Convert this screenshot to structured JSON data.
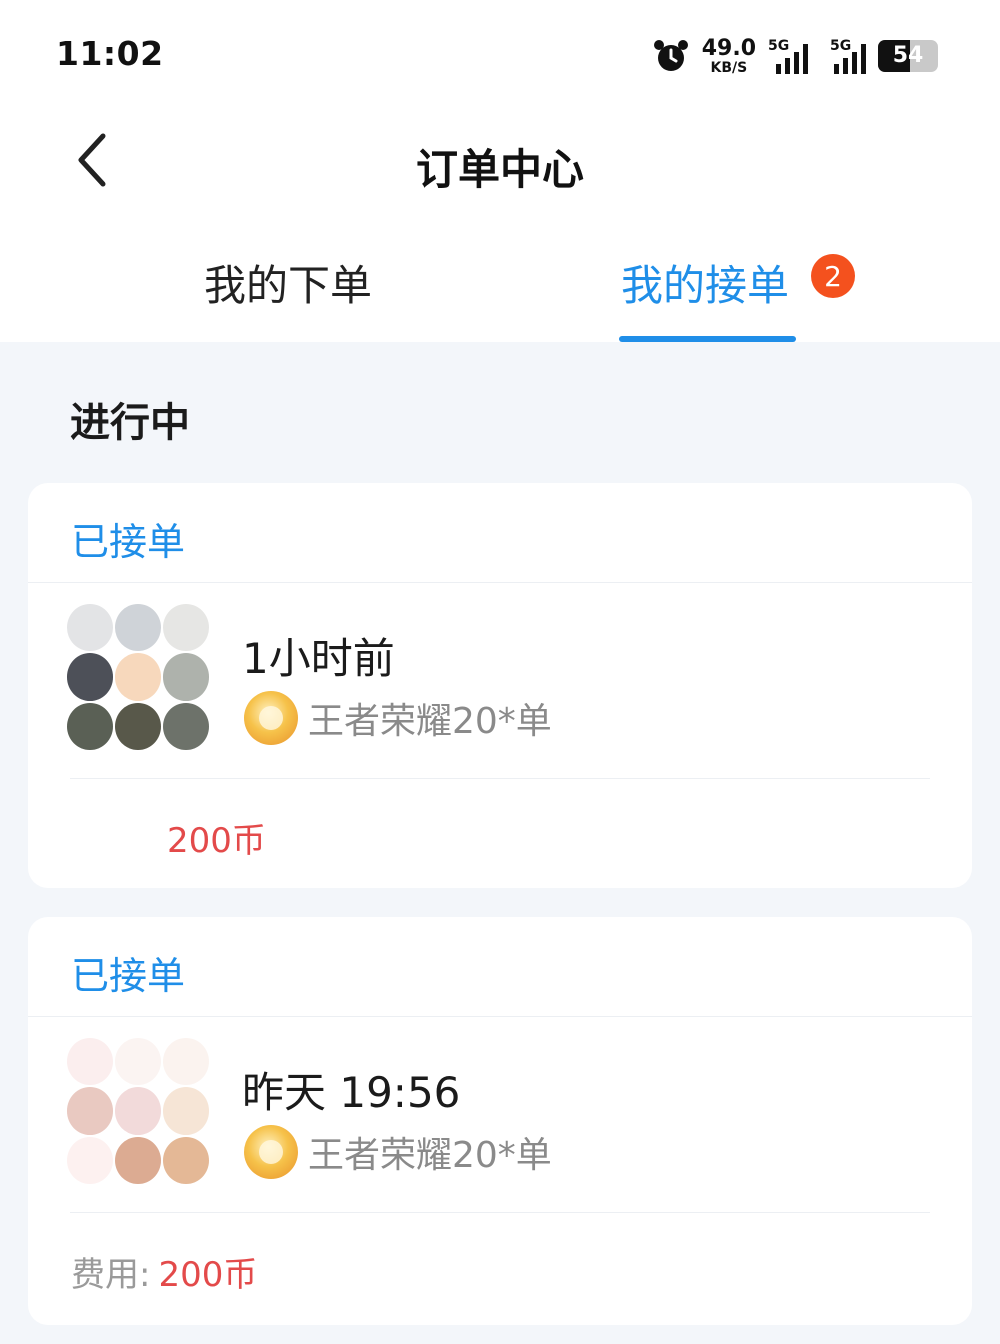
{
  "status_bar": {
    "time": "11:02",
    "net_speed_value": "49.0",
    "net_speed_unit": "KB/S",
    "signal_1_tag": "5G",
    "signal_2_tag": "5G",
    "battery_level": "54",
    "icons": [
      "alarm-icon",
      "signal-icon",
      "signal-icon",
      "battery-icon"
    ]
  },
  "header": {
    "title": "订单中心",
    "back_icon": "chevron-left-icon"
  },
  "tabs": [
    {
      "label": "我的下单",
      "active": false
    },
    {
      "label": "我的接单",
      "active": true,
      "badge": "2"
    }
  ],
  "colors": {
    "accent": "#1f8ee8",
    "badge": "#f4511e",
    "price": "#e34a4a",
    "background": "#f3f6fa"
  },
  "section_title": "进行中",
  "orders": [
    {
      "status": "已接单",
      "time": "1小时前",
      "game": "王者荣耀20*单",
      "game_icon": "honor-of-kings-icon",
      "fee_label": "",
      "fee_value": "200币"
    },
    {
      "status": "已接单",
      "time": "昨天 19:56",
      "game": "王者荣耀20*单",
      "game_icon": "honor-of-kings-icon",
      "fee_label": "费用:",
      "fee_value": "200币"
    }
  ]
}
